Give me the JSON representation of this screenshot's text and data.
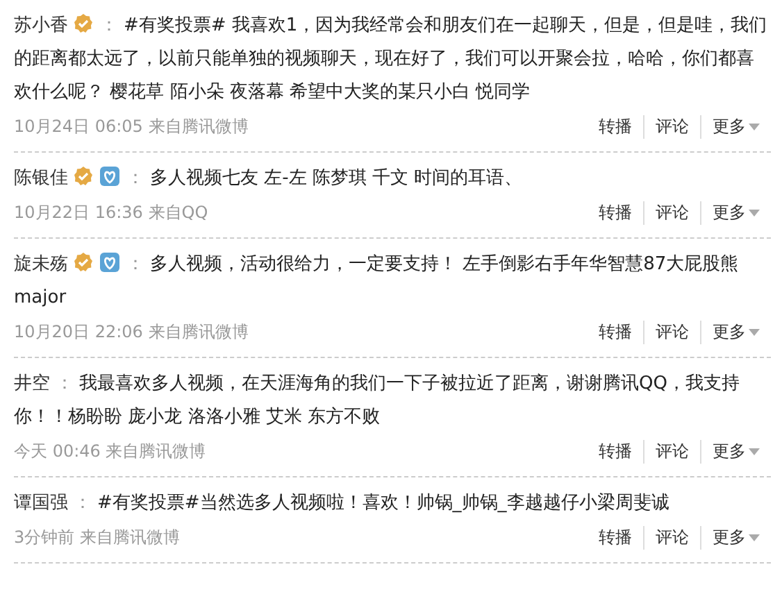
{
  "posts": [
    {
      "author": "苏小香",
      "badges": [
        {
          "kind": "verified"
        }
      ],
      "separator": "：",
      "text": "#有奖投票# 我喜欢1，因为我经常会和朋友们在一起聊天，但是，但是哇，我们的距离都太远了，以前只能单独的视频聊天，现在好了，我们可以开聚会拉，哈哈，你们都喜欢什么呢？ 樱花草 陌小朵 夜落幕 希望中大奖的某只小白 悦同学",
      "time": "10月24日 06:05",
      "source": "来自腾讯微博",
      "actions": [
        "转播",
        "评论",
        "更多"
      ]
    },
    {
      "author": "陈银佳",
      "badges": [
        {
          "kind": "verified"
        },
        {
          "kind": "heart"
        }
      ],
      "separator": "：",
      "text": "多人视频七友 左-左 陈梦琪 千文 时间的耳语、",
      "time": "10月22日 16:36",
      "source": "来自QQ",
      "actions": [
        "转播",
        "评论",
        "更多"
      ]
    },
    {
      "author": "旋未殇",
      "badges": [
        {
          "kind": "verified"
        },
        {
          "kind": "heart"
        }
      ],
      "separator": "：",
      "text": "多人视频，活动很给力，一定要支持！ 左手倒影右手年华智慧87大屁股熊major",
      "time": "10月20日 22:06",
      "source": "来自腾讯微博",
      "actions": [
        "转播",
        "评论",
        "更多"
      ]
    },
    {
      "author": "井空",
      "separator": "：",
      "text": "我最喜欢多人视频，在天涯海角的我们一下子被拉近了距离，谢谢腾讯QQ，我支持你！！杨盼盼 庞小龙 洛洛小雅 艾米 东方不败",
      "time": "今天 00:46",
      "source": "来自腾讯微博",
      "actions": [
        "转播",
        "评论",
        "更多"
      ]
    },
    {
      "author": "谭国强",
      "separator": "：",
      "text": "#有奖投票#当然选多人视频啦！喜欢！帅锅_帅锅_李越越仔小梁周斐诚",
      "time": "3分钟前",
      "source": "来自腾讯微博",
      "actions": [
        "转播",
        "评论",
        "更多"
      ]
    }
  ]
}
